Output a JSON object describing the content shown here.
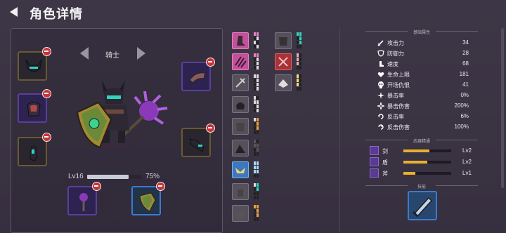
{
  "header": {
    "title": "角色详情",
    "back_icon": "back-arrow-icon"
  },
  "character": {
    "class_name": "骑士",
    "level_text": "Lv16",
    "xp_percent_text": "75%",
    "xp_fraction": 0.75
  },
  "equipment_slots": [
    {
      "name": "helmet",
      "icon": "horned-helmet-icon"
    },
    {
      "name": "armor",
      "icon": "chest-armor-icon"
    },
    {
      "name": "gloves",
      "icon": "gloves-icon"
    },
    {
      "name": "cloak",
      "icon": "cloak-icon"
    },
    {
      "name": "boots",
      "icon": "boots-icon"
    },
    {
      "name": "weapon",
      "icon": "mace-icon"
    },
    {
      "name": "shield",
      "icon": "shield-icon"
    }
  ],
  "stats": {
    "section_title": "基础属性",
    "rows": [
      {
        "label": "攻击力",
        "value": "34",
        "icon": "sword-icon"
      },
      {
        "label": "防御力",
        "value": "28",
        "icon": "shield-icon"
      },
      {
        "label": "速度",
        "value": "68",
        "icon": "boot-icon"
      },
      {
        "label": "生命上限",
        "value": "181",
        "icon": "heart-icon"
      },
      {
        "label": "开场仇恨",
        "value": "41",
        "icon": "skull-icon"
      },
      {
        "label": "暴击率",
        "value": "0%",
        "icon": "crit-icon"
      },
      {
        "label": "暴击伤害",
        "value": "200%",
        "icon": "crit-damage-icon"
      },
      {
        "label": "反击率",
        "value": "6%",
        "icon": "counter-icon"
      },
      {
        "label": "反击伤害",
        "value": "100%",
        "icon": "counter-damage-icon"
      }
    ]
  },
  "weapon_mastery": {
    "section_title": "武器精通",
    "rows": [
      {
        "label": "剑",
        "level": "Lv2",
        "fraction": 0.55,
        "icon": "sword-icon"
      },
      {
        "label": "盾",
        "level": "Lv2",
        "fraction": 0.5,
        "icon": "shield-icon"
      },
      {
        "label": "斧",
        "level": "Lv1",
        "fraction": 0.25,
        "icon": "axe-icon"
      }
    ]
  },
  "skills": {
    "section_title": "技能",
    "icon": "blade-skill-icon"
  },
  "colors": {
    "accent_gold": "#e8b030",
    "remove_red": "#c8343a",
    "skill_blue": "#3c7ad0"
  }
}
